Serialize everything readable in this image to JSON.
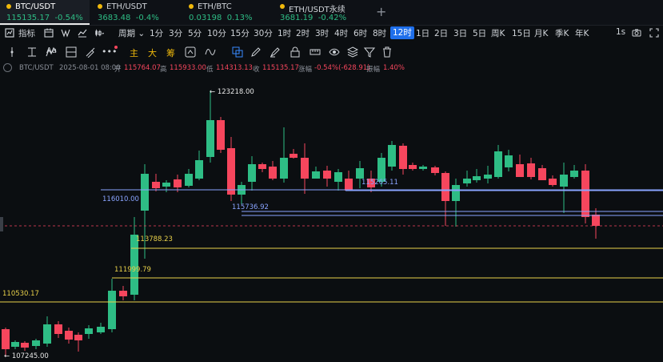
{
  "tabs": [
    {
      "name": "BTC/USDT",
      "price": "115135.17",
      "change": "-0.54%",
      "price_color": "green",
      "change_color": "green"
    },
    {
      "name": "ETH/USDT",
      "price": "3683.48",
      "change": "-0.4%",
      "price_color": "green",
      "change_color": "green"
    },
    {
      "name": "ETH/BTC",
      "price": "0.03198",
      "change": "0.13%",
      "price_color": "green",
      "change_color": "green"
    },
    {
      "name": "ETH/USDT永续",
      "price": "3681.19",
      "change": "-0.42%",
      "price_color": "green",
      "change_color": "green"
    }
  ],
  "toolbar": {
    "indicators_label": "指标",
    "period_label": "周期",
    "intervals": [
      "1分",
      "3分",
      "5分",
      "10分",
      "15分",
      "30分",
      "1时",
      "2时",
      "3时",
      "4时",
      "6时",
      "8时",
      "12时",
      "1日",
      "2日",
      "3日",
      "5日",
      "周K",
      "15日",
      "月K",
      "季K",
      "年K"
    ],
    "active_interval": "12时",
    "speed_label": "1s"
  },
  "draw_tools": {
    "zhu": "主",
    "da": "大",
    "chou": "筹"
  },
  "ohlc": {
    "symbol": "BTC/USDT",
    "time": "2025-08-01 08:00",
    "open_label": "开",
    "open": "115764.07",
    "high_label": "高",
    "high": "115933.00",
    "low_label": "低",
    "low": "114313.13",
    "close_label": "收",
    "close": "115135.17",
    "change_label": "涨幅",
    "change": "-0.54%(-628.91)",
    "amp_label": "振幅",
    "amp": "1.40%"
  },
  "levels": [
    {
      "label": "← 123218.00",
      "price": 123218.0,
      "kind": "marker"
    },
    {
      "label": "116010.00",
      "price": 116010.0,
      "kind": "line",
      "color": "#8aa4ff"
    },
    {
      "label": "115736.92",
      "price": 115736.92,
      "kind": "line",
      "color": "#8aa4ff"
    },
    {
      "label": "115265.11",
      "price": 115265.11,
      "kind": "line",
      "color": "#8aa4ff"
    },
    {
      "label": "113788.23",
      "price": 113788.23,
      "kind": "line",
      "color": "#e8d14a"
    },
    {
      "label": "111999.79",
      "price": 111999.79,
      "kind": "line",
      "color": "#e8d14a"
    },
    {
      "label": "110530.17",
      "price": 110530.17,
      "kind": "line",
      "color": "#e8d14a"
    },
    {
      "label": "← 107245.00",
      "price": 107245.0,
      "kind": "marker"
    }
  ],
  "colors": {
    "up": "#2ebd85",
    "down": "#f6465d",
    "background": "#0b0e11",
    "accent": "#1f6feb"
  }
}
